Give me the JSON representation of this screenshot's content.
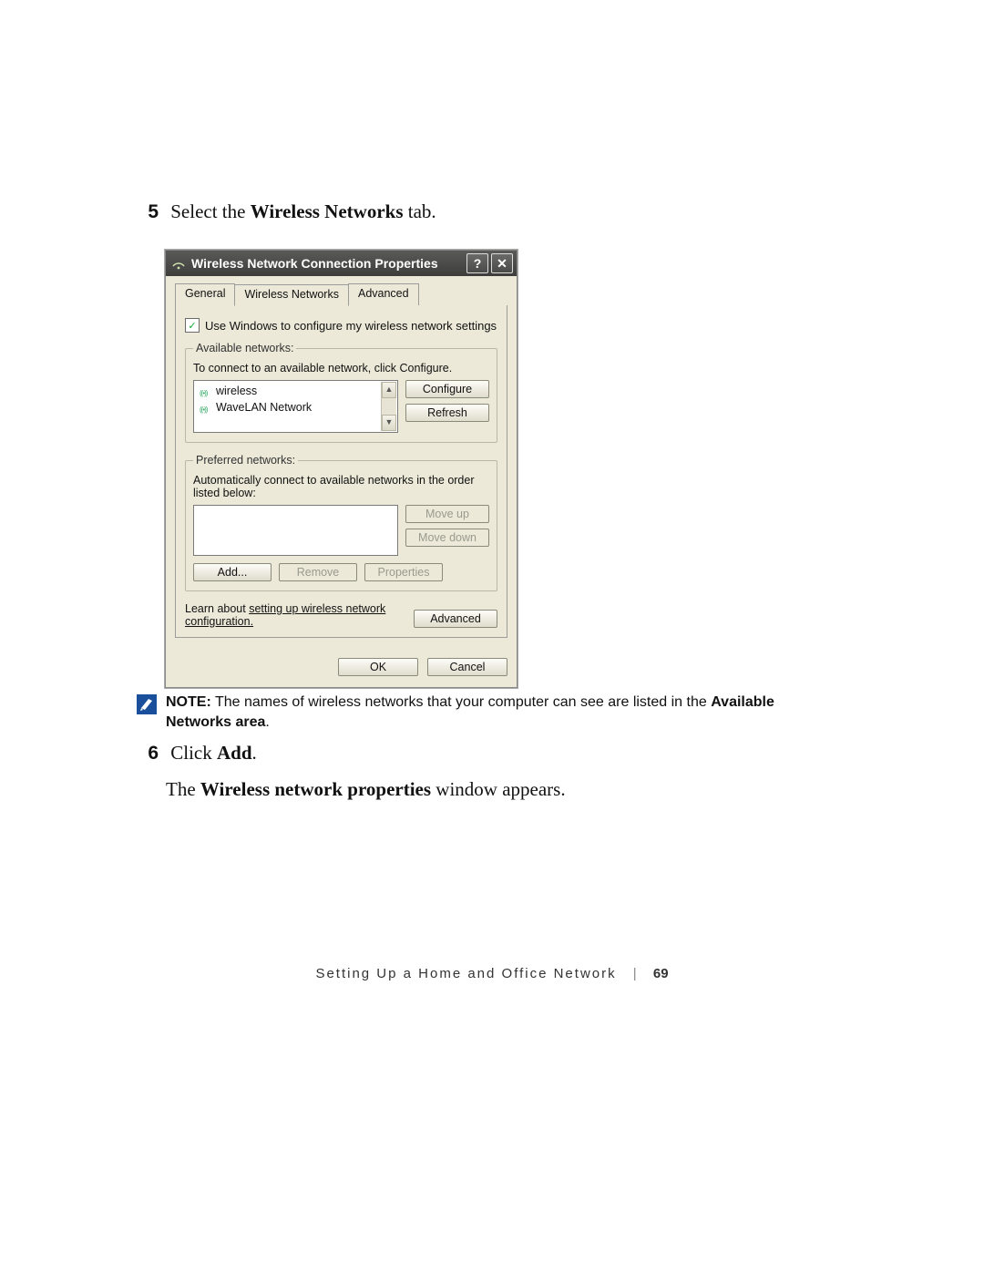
{
  "step5": {
    "num": "5",
    "text_pre": "Select the ",
    "text_bold": "Wireless Networks",
    "text_post": " tab."
  },
  "dialog": {
    "title": "Wireless Network Connection Properties",
    "help_btn": "?",
    "close_btn": "✕",
    "tabs": {
      "general": "General",
      "wireless": "Wireless Networks",
      "advanced": "Advanced"
    },
    "checkbox_label": "Use Windows to configure my wireless network settings",
    "available": {
      "legend": "Available networks:",
      "hint": "To connect to an available network, click Configure.",
      "items": [
        "wireless",
        "WaveLAN Network"
      ],
      "configure_btn": "Configure",
      "refresh_btn": "Refresh"
    },
    "preferred": {
      "legend": "Preferred networks:",
      "hint": "Automatically connect to available networks in the order listed below:",
      "moveup_btn": "Move up",
      "movedown_btn": "Move down",
      "add_btn": "Add...",
      "remove_btn": "Remove",
      "properties_btn": "Properties"
    },
    "learn": {
      "pre": "Learn about ",
      "link1": "setting up wireless network",
      "link2": "configuration.",
      "advanced_btn": "Advanced"
    },
    "ok_btn": "OK",
    "cancel_btn": "Cancel"
  },
  "note": {
    "label": "NOTE:",
    "text": " The names of wireless networks that your computer can see are listed in the ",
    "bold1": "Available Networks area",
    "tail": "."
  },
  "step6": {
    "num": "6",
    "line1_pre": "Click ",
    "line1_bold": "Add",
    "line1_post": ".",
    "line2_pre": "The ",
    "line2_bold": "Wireless network properties",
    "line2_post": " window appears."
  },
  "footer": {
    "section": "Setting Up a Home and Office Network",
    "page": "69"
  }
}
